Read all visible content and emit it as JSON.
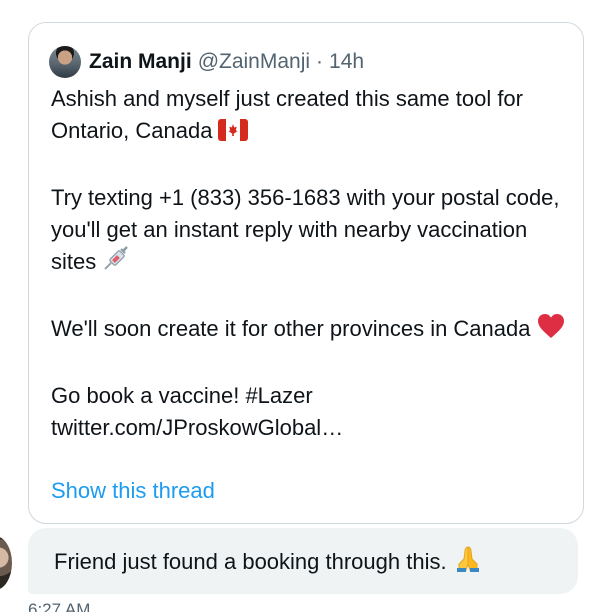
{
  "quoted_tweet": {
    "author_name": "Zain Manji",
    "author_handle": "@ZainManji",
    "separator": "·",
    "time": "14h",
    "paragraphs": {
      "p1": "Ashish and myself just created this same tool for Ontario, Canada",
      "p2": "Try texting +1 (833) 356-1683 with your postal code, you'll get an instant reply with nearby vaccination sites",
      "p3": "We'll soon create it for other provinces in Canada",
      "p4_line1": "Go book a vaccine! #Lazer",
      "p4_line2": "twitter.com/JProskowGlobal…"
    },
    "emoji_icons": [
      "canada-flag-icon",
      "syringe-icon",
      "red-heart-icon"
    ],
    "show_thread_label": "Show this thread"
  },
  "message": {
    "text": "Friend just found a booking through this.",
    "emoji_icon": "folded-hands-icon",
    "timestamp": "6:27 AM"
  },
  "colors": {
    "link": "#1d9bf0",
    "bubble_bg": "#eff3f4",
    "card_border": "#cfd9de",
    "secondary_text": "#536471"
  }
}
